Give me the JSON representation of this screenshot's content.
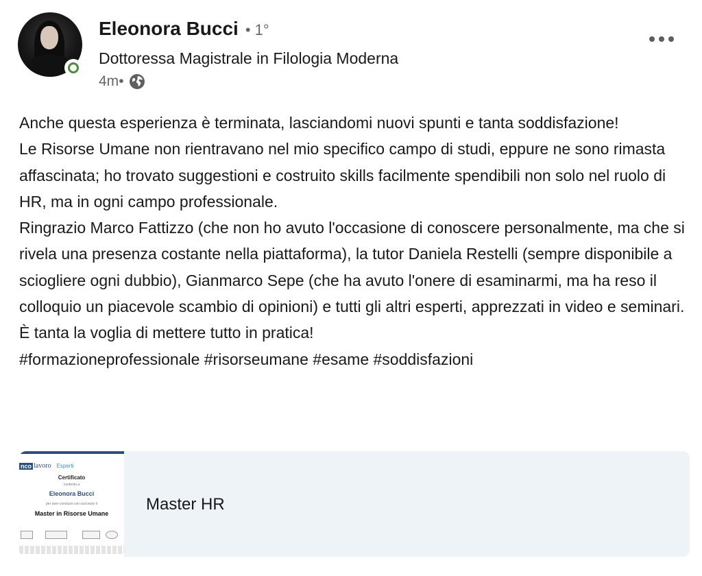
{
  "post": {
    "author": {
      "name": "Eleonora Bucci",
      "connection_degree": "• 1°",
      "headline": "Dottoressa Magistrale in Filologia Moderna",
      "online_status_color": "#4c8a3c"
    },
    "time_ago": "4m",
    "time_separator": "•",
    "visibility_icon": "globe-icon",
    "more_icon": "more-horizontal-icon",
    "text_lines": [
      "Anche questa esperienza è terminata, lasciandomi nuovi spunti e tanta soddisfazione!",
      "Le Risorse Umane non rientravano nel mio specifico campo di studi, eppure ne sono rimasta affascinata; ho trovato suggestioni e costruito skills facilmente spendibili non solo nel ruolo di HR, ma in ogni campo professionale.",
      "Ringrazio Marco Fattizzo (che non ho avuto l'occasione di conoscere personalmente, ma che si rivela una presenza costante nella piattaforma), la tutor Daniela Restelli (sempre disponibile a sciogliere ogni dubbio), Gianmarco Sepe (che ha avuto l'onere di esaminarmi, ma ha reso il colloquio un piacevole scambio di opinioni) e tutti gli altri esperti, apprezzati in video e seminari.",
      "È tanta la voglia di mettere tutto in pratica!"
    ],
    "hashtags": "#formazioneprofessionale #risorseumane #esame #soddisfazioni",
    "attachment": {
      "title": "Master HR",
      "background_color": "#eef3f8",
      "thumbnail": {
        "logo_box": "nco",
        "logo_word": "lavoro",
        "logo_partner": "Esperti",
        "heading": "Certificato",
        "conferred": "conferito a",
        "recipient": "Eleonora Bucci",
        "completed": "per aver concluso con successo il",
        "course": "Master in Risorse Umane"
      }
    }
  }
}
